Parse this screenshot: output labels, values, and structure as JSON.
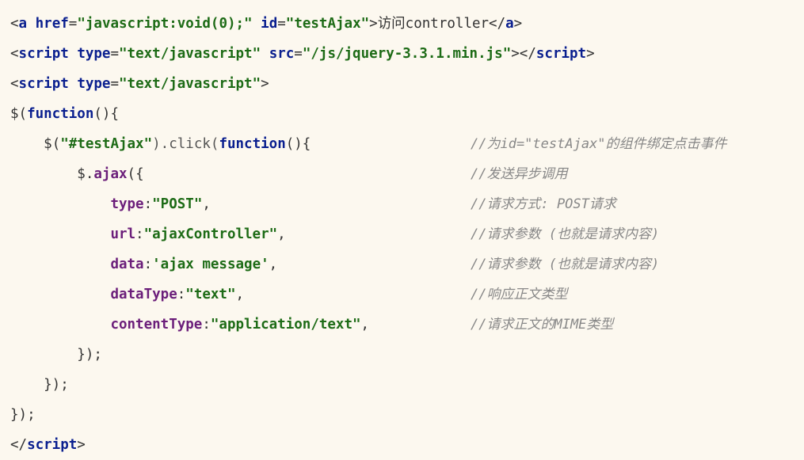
{
  "lines": {
    "l1": {
      "lt": "<",
      "tag": "a",
      "sp1": " ",
      "attr1": "href",
      "eq1": "=",
      "val1": "\"javascript:void(0);\"",
      "sp2": " ",
      "attr2": "id",
      "eq2": "=",
      "val2": "\"testAjax\"",
      "gt": ">",
      "text": "访问controller",
      "close_lt": "</",
      "close_tag": "a",
      "close_gt": ">"
    },
    "l2": {
      "lt": "<",
      "tag": "script",
      "sp1": " ",
      "attr1": "type",
      "eq1": "=",
      "val1": "\"text/javascript\"",
      "sp2": " ",
      "attr2": "src",
      "eq2": "=",
      "val2": "\"/js/jquery-3.3.1.min.js\"",
      "gt": ">",
      "close_lt": "</",
      "close_tag": "script",
      "close_gt": ">"
    },
    "l3": {
      "lt": "<",
      "tag": "script",
      "sp1": " ",
      "attr1": "type",
      "eq1": "=",
      "val1": "\"text/javascript\"",
      "gt": ">"
    },
    "l4": {
      "pre": "$(",
      "kw": "function",
      "post": "(){"
    },
    "l5": {
      "indent": "    ",
      "pre": "$(",
      "str": "\"#testAjax\"",
      "mid": ").click(",
      "kw": "function",
      "post": "(){"
    },
    "l6": {
      "indent": "        ",
      "pre": "$.",
      "prop": "ajax",
      "post": "({"
    },
    "l7": {
      "indent": "            ",
      "prop": "type",
      "colon": ":",
      "str": "\"POST\"",
      "post": ","
    },
    "l8": {
      "indent": "            ",
      "prop": "url",
      "colon": ":",
      "str": "\"ajaxController\"",
      "post": ","
    },
    "l9": {
      "indent": "            ",
      "prop": "data",
      "colon": ":",
      "str": "'ajax message'",
      "post": ","
    },
    "l10": {
      "indent": "            ",
      "prop": "dataType",
      "colon": ":",
      "str": "\"text\"",
      "post": ","
    },
    "l11": {
      "indent": "            ",
      "prop": "contentType",
      "colon": ":",
      "str": "\"application/text\"",
      "post": ","
    },
    "l12": {
      "text": "        });"
    },
    "l13": {
      "text": "    });"
    },
    "l14": {
      "text": "});"
    },
    "l15": {
      "lt": "</",
      "tag": "script",
      "gt": ">"
    }
  },
  "comments": {
    "c5": "//为id=\"testAjax\"的组件绑定点击事件",
    "c6": "//发送异步调用",
    "c7": "//请求方式: POST请求",
    "c8": "//请求参数 (也就是请求内容)",
    "c9": "//请求参数 (也就是请求内容)",
    "c10": "//响应正文类型",
    "c11": "//请求正文的MIME类型"
  }
}
